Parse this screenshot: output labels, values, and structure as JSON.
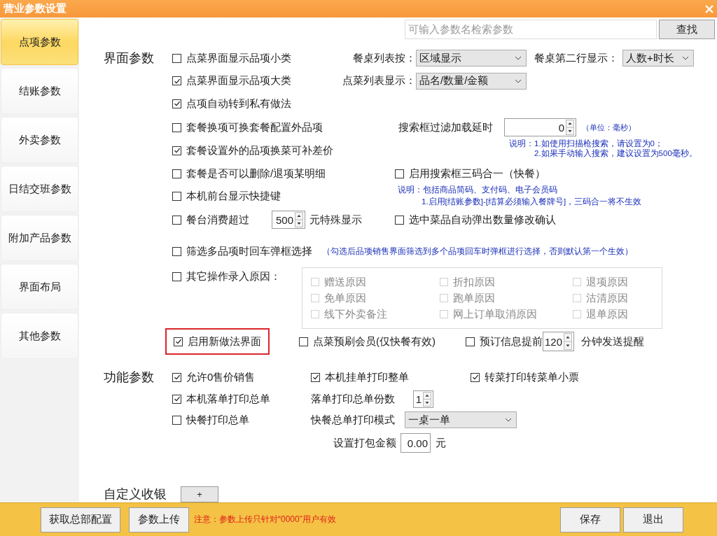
{
  "window": {
    "title": "营业参数设置"
  },
  "sidebar": {
    "items": [
      {
        "label": "点项参数",
        "selected": true
      },
      {
        "label": "结账参数",
        "selected": false
      },
      {
        "label": "外卖参数",
        "selected": false
      },
      {
        "label": "日结交班参数",
        "selected": false
      },
      {
        "label": "附加产品参数",
        "selected": false
      },
      {
        "label": "界面布局",
        "selected": false
      },
      {
        "label": "其他参数",
        "selected": false
      }
    ]
  },
  "search": {
    "placeholder": "可输入参数名检索参数",
    "button": "查找"
  },
  "interface": {
    "heading": "界面参数",
    "options": [
      {
        "label": "点菜界面显示品项小类",
        "checked": false
      },
      {
        "label": "点菜界面显示品项大类",
        "checked": true
      },
      {
        "label": "点项自动转到私有做法",
        "checked": true
      },
      {
        "label": "套餐换项可换套餐配置外品项",
        "checked": false
      },
      {
        "label": "套餐设置外的品项换菜可补差价",
        "checked": true
      },
      {
        "label": "套餐是否可以删除/退项某明细",
        "checked": false
      },
      {
        "label": "本机前台显示快捷键",
        "checked": false
      }
    ],
    "table_list_by": {
      "label": "餐桌列表按：",
      "value": "区域显示"
    },
    "table_second_line": {
      "label": "餐桌第二行显示：",
      "value": "人数+时长"
    },
    "order_list": {
      "label": "点菜列表显示：",
      "value": "品名/数量/金额"
    },
    "search_delay": {
      "label": "搜索框过滤加载延时",
      "value": "0",
      "unit": "（单位：毫秒）",
      "notes": [
        "说明：1.如使用扫描枪搜索，请设置为0；",
        "2.如果手动输入搜索，建议设置为500毫秒。"
      ]
    },
    "three_in_one": {
      "label": "启用搜索框三码合一（快餐）",
      "checked": false,
      "notes": [
        "说明：包括商品简码、支付码、电子会员码",
        "1.启用[结账参数]-[结算必须输入餐牌号]，三码合一将不生效"
      ]
    },
    "special_display": {
      "label": "餐台消费超过",
      "checked": false,
      "value": "500",
      "suffix": "元特殊显示"
    },
    "auto_quantity": {
      "label": "选中菜品自动弹出数量修改确认",
      "checked": false
    },
    "multi_select": {
      "label": "筛选多品项时回车弹框选择",
      "checked": false,
      "note": "（勾选后品项销售界面筛选到多个品项回车时弹框进行选择，否则默认第一个生效）"
    },
    "reasons": {
      "label": "其它操作录入原因：",
      "checked": false,
      "items": [
        {
          "label": "赠送原因",
          "checked": false,
          "disabled": true
        },
        {
          "label": "折扣原因",
          "checked": false,
          "disabled": true
        },
        {
          "label": "退项原因",
          "checked": false,
          "disabled": true
        },
        {
          "label": "免单原因",
          "checked": false,
          "disabled": true
        },
        {
          "label": "跑单原因",
          "checked": false,
          "disabled": true
        },
        {
          "label": "沽清原因",
          "checked": false,
          "disabled": true
        },
        {
          "label": "线下外卖备注",
          "checked": false,
          "disabled": true
        },
        {
          "label": "网上订单取消原因",
          "checked": false,
          "disabled": true
        },
        {
          "label": "退单原因",
          "checked": false,
          "disabled": true
        }
      ]
    },
    "new_method": {
      "label": "启用新做法界面",
      "checked": true,
      "highlighted": true
    },
    "prepay_member": {
      "label": "点菜预刷会员(仅快餐有效)",
      "checked": false
    },
    "reservation": {
      "label": "预订信息提前",
      "checked": false,
      "value": "120",
      "suffix": "分钟发送提醒"
    }
  },
  "function": {
    "heading": "功能参数",
    "options": [
      {
        "label": "允许0售价销售",
        "checked": true
      },
      {
        "label": "本机挂单打印整单",
        "checked": true
      },
      {
        "label": "转菜打印转菜单小票",
        "checked": true
      },
      {
        "label": "本机落单打印总单",
        "checked": true
      },
      {
        "label": "快餐打印总单",
        "checked": false
      }
    ],
    "copies": {
      "label": "落单打印总单份数",
      "value": "1"
    },
    "fast_mode": {
      "label": "快餐总单打印模式",
      "value": "一桌一单"
    },
    "package_amount": {
      "label": "设置打包金额",
      "value": "0.00",
      "suffix": "元"
    }
  },
  "custom": {
    "heading": "自定义收银",
    "button": "+"
  },
  "footer": {
    "buttons": [
      "获取总部配置",
      "参数上传"
    ],
    "note": "注意：参数上传只针对“0000”用户有效",
    "actions": [
      "保存",
      "退出"
    ]
  }
}
